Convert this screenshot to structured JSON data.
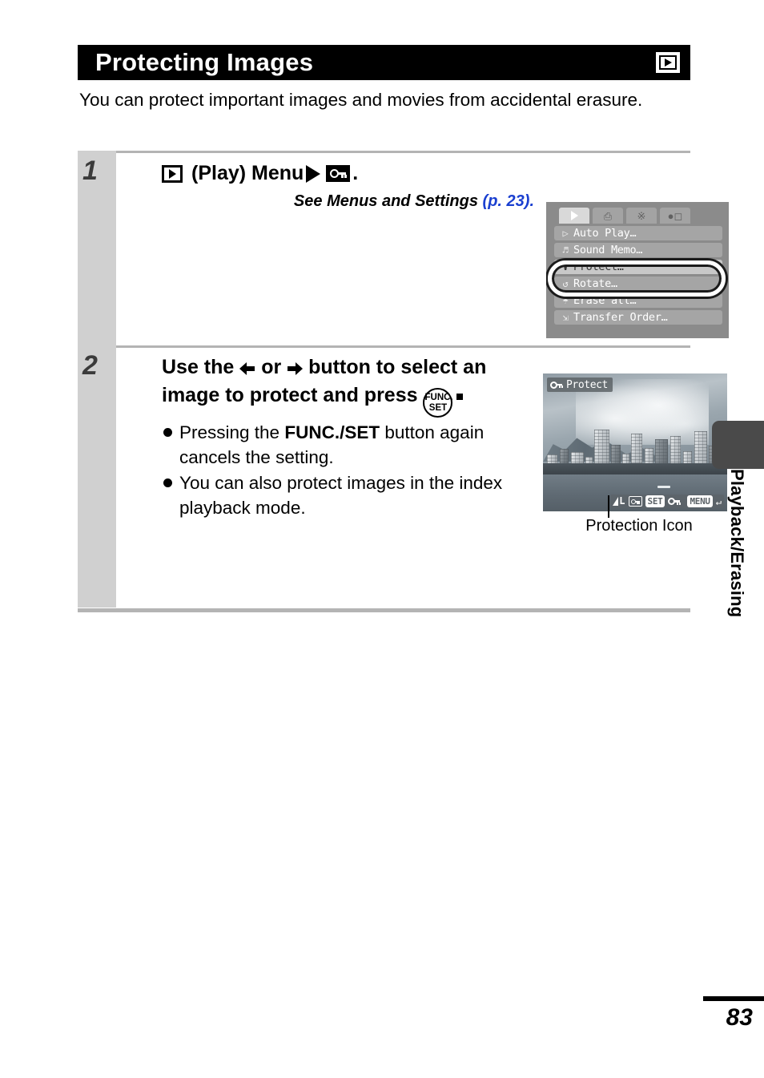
{
  "page": {
    "title": "Protecting Images",
    "title_icon": "play-mode-icon",
    "intro": "You can protect important images and movies from accidental erasure.",
    "number": "83",
    "side_tab_label": "Playback/Erasing"
  },
  "steps": [
    {
      "number": "1",
      "heading_icon": "play-mode-icon",
      "heading_text": "(Play) Menu",
      "heading_arrow": "triangle-right-icon",
      "heading_end_icon": "protect-key-icon",
      "heading_period": ".",
      "reference": "See Menus and Settings",
      "reference_page": "(p. 23).",
      "screen": {
        "type": "camera-menu",
        "tabs": [
          {
            "name": "play-tab",
            "icon": "play-triangle-icon",
            "selected": true
          },
          {
            "name": "print-tab",
            "icon": "printer-icon",
            "selected": false
          },
          {
            "name": "setup-tab",
            "icon": "tools-icon",
            "selected": false
          },
          {
            "name": "my-camera-tab",
            "icon": "my-camera-icon",
            "selected": false
          }
        ],
        "items": [
          {
            "icon": "auto-play-icon",
            "label": "Auto Play…",
            "selected": false,
            "obscured": false
          },
          {
            "icon": "sound-memo-icon",
            "label": "Sound Memo…",
            "selected": false,
            "obscured": true
          },
          {
            "icon": "protect-key-icon",
            "label": "Protect…",
            "selected": true,
            "obscured": false
          },
          {
            "icon": "rotate-icon",
            "label": "Rotate…",
            "selected": false,
            "obscured": true
          },
          {
            "icon": "erase-all-icon",
            "label": "Erase all…",
            "selected": false,
            "obscured": false
          },
          {
            "icon": "transfer-order-icon",
            "label": "Transfer Order…",
            "selected": false,
            "obscured": false
          }
        ],
        "highlight_ring_on": "Protect…"
      }
    },
    {
      "number": "2",
      "heading_part1": "Use the",
      "heading_left_arrow": "arrow-left-icon",
      "heading_or": "or",
      "heading_right_arrow": "arrow-right-icon",
      "heading_part2": "button to select an image to protect and press",
      "heading_button_line1": "FUNC.",
      "heading_button_line2": "SET",
      "heading_period": ".",
      "bullets": [
        {
          "text_before": "Pressing the ",
          "bold": "FUNC./SET",
          "text_after": " button again cancels the setting."
        },
        {
          "text_before": "You can also protect images in the index playback mode.",
          "bold": "",
          "text_after": ""
        }
      ],
      "screen": {
        "type": "camera-lcd",
        "overlay_tag_icon": "protect-key-icon",
        "overlay_tag_label": "Protect",
        "status_bar": {
          "quality": "L",
          "protect_icon": "protection-icon",
          "set_button": "SET",
          "set_action_icon": "protect-key-icon",
          "menu_button": "MENU",
          "return_icon": "return-arrow-icon"
        },
        "photo_description": "City skyline over water"
      },
      "callout_label": "Protection Icon"
    }
  ],
  "colors": {
    "title_bar_bg": "#000000",
    "step_number_column": "#d0d0d0",
    "rule": "#b4b4b4",
    "link_blue": "#1a3fd0",
    "side_tab": "#4a4a4a"
  }
}
